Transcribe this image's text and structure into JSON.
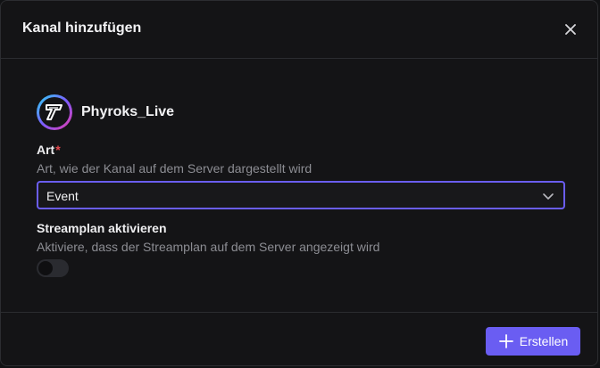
{
  "dialog": {
    "title": "Kanal hinzufügen"
  },
  "channel": {
    "name": "Phyroks_Live",
    "avatar_icon": "phyroks-logo"
  },
  "art_field": {
    "label": "Art",
    "required_marker": "*",
    "description": "Art, wie der Kanal auf dem Server dargestellt wird",
    "selected_value": "Event"
  },
  "streamplan_field": {
    "label": "Streamplan aktivieren",
    "description": "Aktiviere, dass der Streamplan auf dem Server angezeigt wird",
    "enabled": false
  },
  "footer": {
    "create_label": "Erstellen",
    "create_icon": "plus-icon"
  },
  "colors": {
    "accent": "#6a5df2",
    "required": "#e5484d",
    "background": "#141416"
  }
}
